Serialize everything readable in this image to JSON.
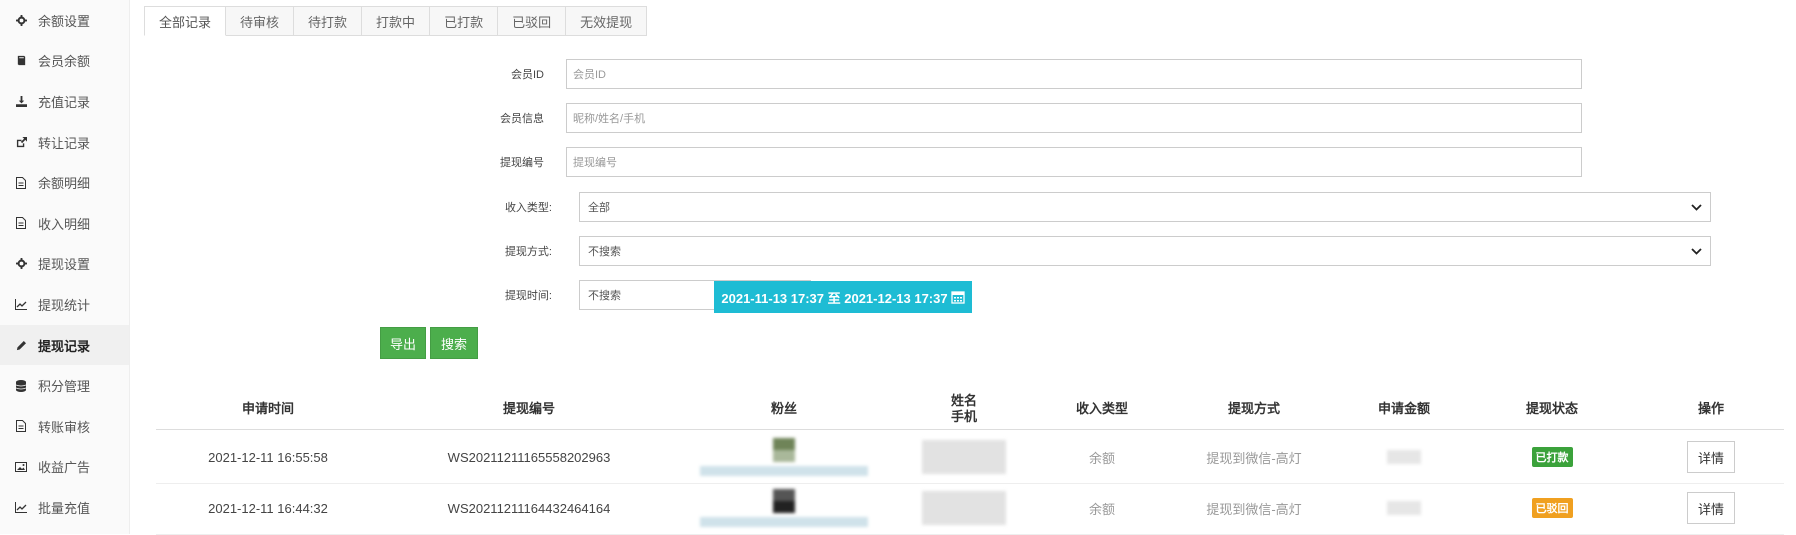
{
  "sidebar": {
    "items": [
      {
        "label": "余额设置",
        "icon": "gear-icon"
      },
      {
        "label": "会员余额",
        "icon": "book-icon"
      },
      {
        "label": "充值记录",
        "icon": "download-icon"
      },
      {
        "label": "转让记录",
        "icon": "external-link-icon"
      },
      {
        "label": "余额明细",
        "icon": "document-icon"
      },
      {
        "label": "收入明细",
        "icon": "document-icon"
      },
      {
        "label": "提现设置",
        "icon": "gear-icon"
      },
      {
        "label": "提现统计",
        "icon": "line-chart-icon"
      },
      {
        "label": "提现记录",
        "icon": "pencil-icon"
      },
      {
        "label": "积分管理",
        "icon": "database-icon"
      },
      {
        "label": "转账审核",
        "icon": "document-icon"
      },
      {
        "label": "收益广告",
        "icon": "image-icon"
      },
      {
        "label": "批量充值",
        "icon": "line-chart-icon"
      }
    ],
    "active_index": 8
  },
  "tabs": [
    "全部记录",
    "待审核",
    "待打款",
    "打款中",
    "已打款",
    "已驳回",
    "无效提现"
  ],
  "filters": {
    "member_id": {
      "label": "会员ID",
      "placeholder": "会员ID"
    },
    "member_info": {
      "label": "会员信息",
      "placeholder": "昵称/姓名/手机"
    },
    "withdraw_no": {
      "label": "提现编号",
      "placeholder": "提现编号"
    },
    "income_type": {
      "label": "收入类型:",
      "value": "全部"
    },
    "withdraw_method": {
      "label": "提现方式:",
      "value": "不搜索"
    },
    "withdraw_time": {
      "label": "提现时间:",
      "value": "不搜索"
    },
    "date_range": "2021-11-13 17:37 至 2021-12-13 17:37"
  },
  "buttons": {
    "export": "导出",
    "search": "搜索"
  },
  "table": {
    "headers": [
      "申请时间",
      "提现编号",
      "粉丝",
      "姓名",
      "手机",
      "收入类型",
      "提现方式",
      "申请金额",
      "提现状态",
      "操作"
    ],
    "rows": [
      {
        "time": "2021-12-11 16:55:58",
        "no": "WS20211211165558202963",
        "income_type": "余额",
        "method": "提现到微信-高灯",
        "status": "已打款",
        "action": "详情"
      },
      {
        "time": "2021-12-11 16:44:32",
        "no": "WS20211211164432464164",
        "income_type": "余额",
        "method": "提现到微信-高灯",
        "status": "已驳回",
        "action": "详情"
      }
    ]
  },
  "colors": {
    "paid": "#3ba23b",
    "rejected": "#f0a020",
    "date_button": "#1ebcd4",
    "green_button": "#4cae4c"
  }
}
